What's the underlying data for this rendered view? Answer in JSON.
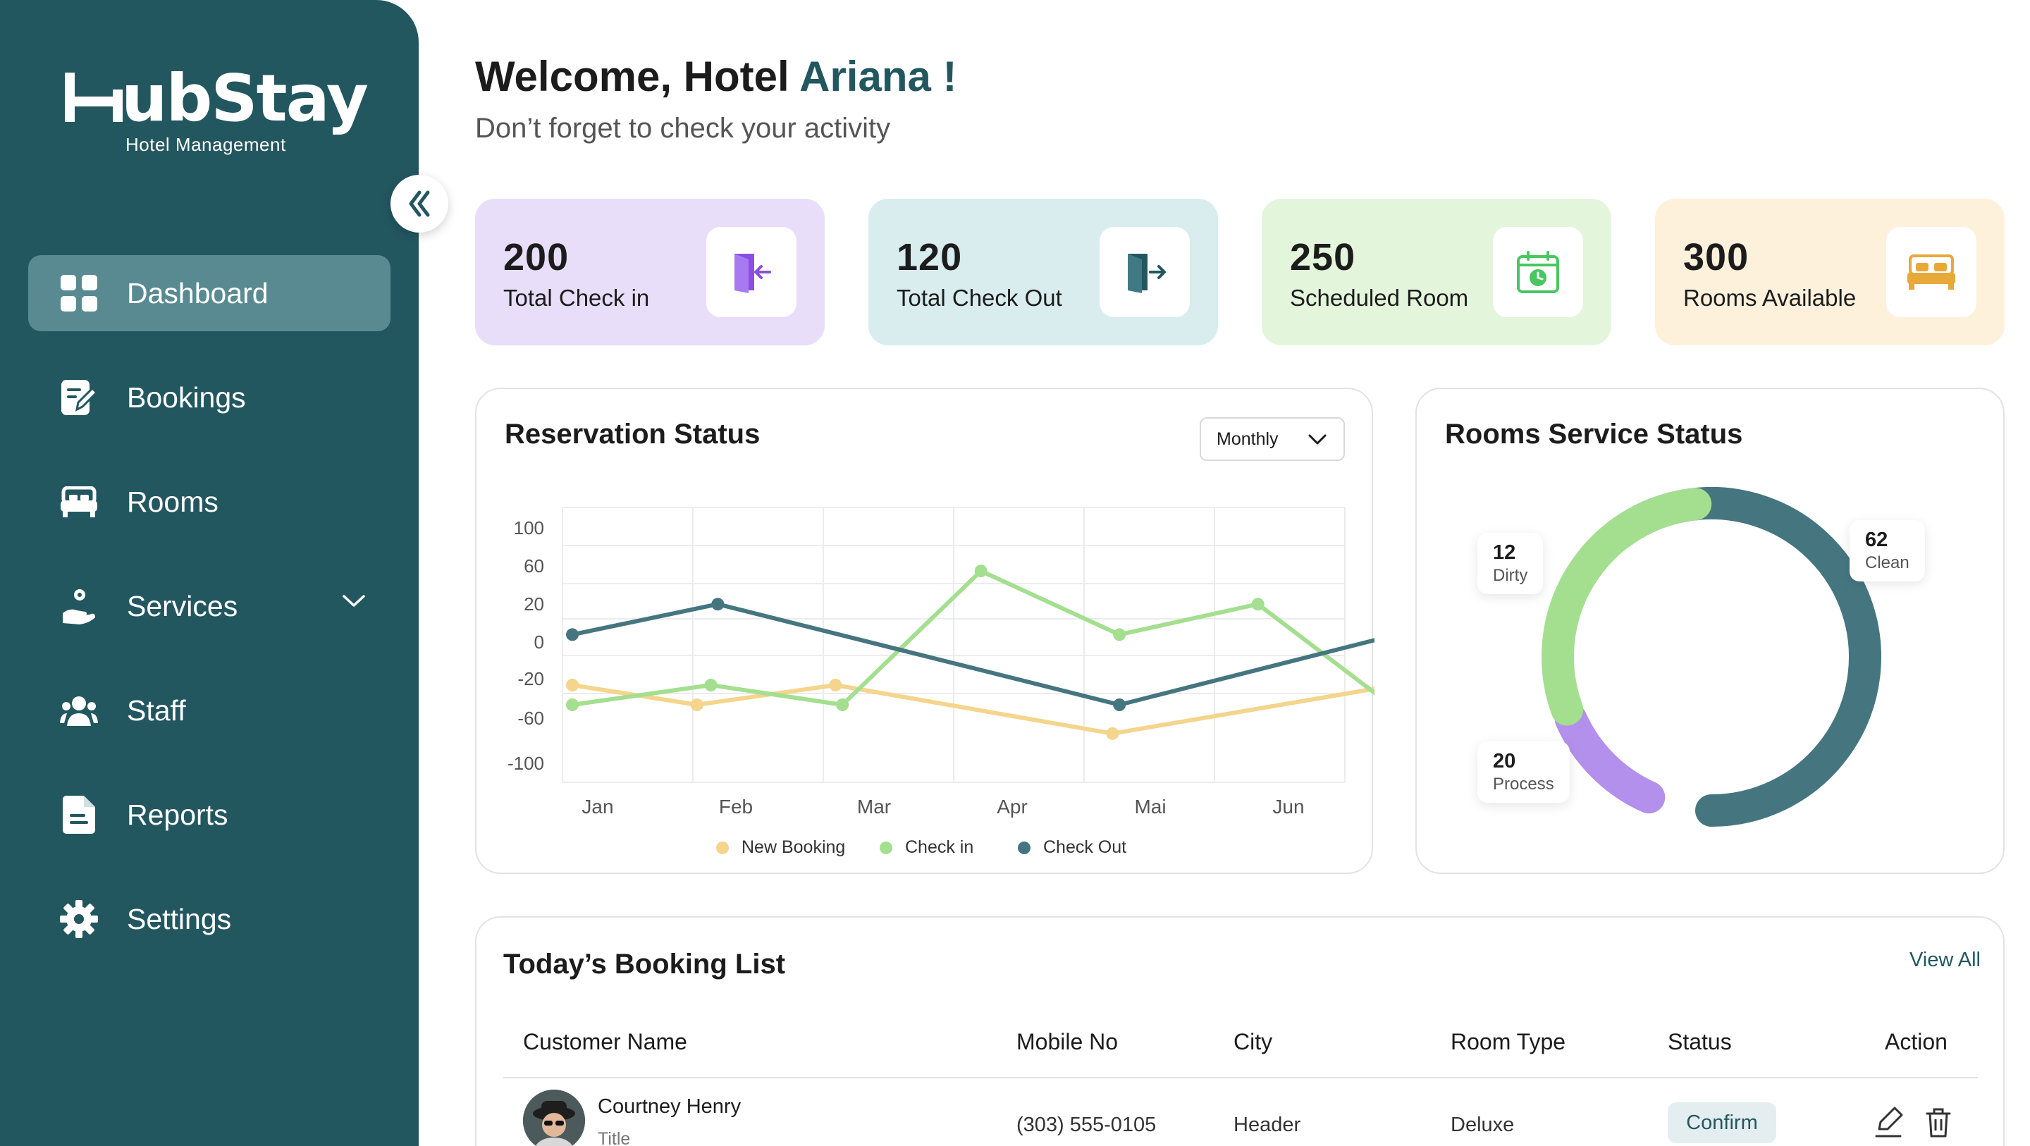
{
  "brand": {
    "name": "HubStay",
    "name_rest": "ubStay",
    "tagline": "Hotel Management"
  },
  "nav": {
    "items": [
      {
        "label": "Dashboard",
        "icon": "grid-icon",
        "active": true
      },
      {
        "label": "Bookings",
        "icon": "edit-note-icon"
      },
      {
        "label": "Rooms",
        "icon": "bed-icon"
      },
      {
        "label": "Services",
        "icon": "hand-service-icon"
      },
      {
        "label": "Staff",
        "icon": "users-icon"
      },
      {
        "label": "Reports",
        "icon": "report-file-icon"
      },
      {
        "label": "Settings",
        "icon": "gear-icon"
      }
    ]
  },
  "header": {
    "welcome_prefix": "Welcome, Hotel",
    "welcome_name": "Ariana !",
    "subtitle": "Don’t forget to check your activity"
  },
  "stats": [
    {
      "value": "200",
      "label": "Total Check in",
      "bg": "#e8defa",
      "icon": "check-in-icon",
      "icon_color": "#8a4fe0"
    },
    {
      "value": "120",
      "label": "Total Check Out",
      "bg": "#d9ecee",
      "icon": "check-out-icon",
      "icon_color": "#235760"
    },
    {
      "value": "250",
      "label": "Scheduled Room",
      "bg": "#e3f6dc",
      "icon": "calendar-clock-icon",
      "icon_color": "#48c760"
    },
    {
      "value": "300",
      "label": "Rooms Available",
      "bg": "#fdf1dc",
      "icon": "bed-icon",
      "icon_color": "#e8a83a"
    }
  ],
  "reservation": {
    "title": "Reservation Status",
    "period": "Monthly"
  },
  "chart_data": {
    "type": "line",
    "title": "Reservation Status",
    "categories": [
      "Jan",
      "Feb",
      "Mar",
      "Apr",
      "Mai",
      "Jun"
    ],
    "y_ticks": [
      "100",
      "60",
      "20",
      "0",
      "-20",
      "-60",
      "-100"
    ],
    "ylabel": "",
    "xlabel": "",
    "grid": true,
    "legend_position": "bottom",
    "series": [
      {
        "name": "New Booking",
        "color": "#f5d48c",
        "points": [
          [
            0.0,
            -20
          ],
          [
            0.9,
            -40
          ],
          [
            1.9,
            -20
          ],
          [
            3.9,
            -68
          ],
          [
            5.95,
            -20
          ]
        ]
      },
      {
        "name": "Check in",
        "color": "#a3df8f",
        "points": [
          [
            0.0,
            -40
          ],
          [
            1.0,
            -20
          ],
          [
            1.95,
            -40
          ],
          [
            2.95,
            63
          ],
          [
            3.95,
            8
          ],
          [
            4.95,
            28
          ],
          [
            6.0,
            -50
          ]
        ]
      },
      {
        "name": "Check Out",
        "color": "#457680",
        "points": [
          [
            0.0,
            8
          ],
          [
            1.05,
            28
          ],
          [
            3.95,
            -40
          ],
          [
            5.95,
            8
          ]
        ]
      }
    ]
  },
  "room_service": {
    "title": "Rooms Service Status",
    "segments": [
      {
        "label": "Clean",
        "value": "62",
        "color": "#457680"
      },
      {
        "label": "Dirty",
        "value": "12",
        "color": "#b390ec"
      },
      {
        "label": "Process",
        "value": "20",
        "color": "#a3df8f"
      }
    ]
  },
  "bookings": {
    "title": "Today’s Booking List",
    "view_all": "View All",
    "columns": [
      "Customer Name",
      "Mobile No",
      "City",
      "Room Type",
      "Status",
      "Action"
    ],
    "rows": [
      {
        "name": "Courtney Henry",
        "subtitle": "Title",
        "mobile": "(303) 555-0105",
        "city": "Header",
        "room_type": "Deluxe",
        "status": "Confirm"
      }
    ]
  }
}
